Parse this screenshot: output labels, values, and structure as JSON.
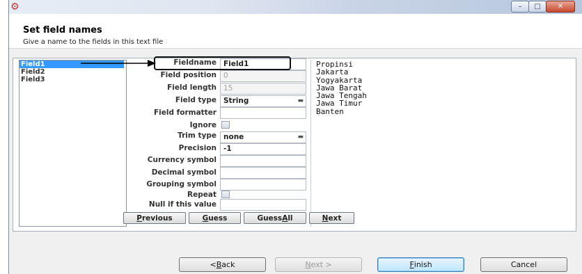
{
  "window": {
    "icon": "kettle-icon",
    "controls": {
      "minimize": "–",
      "maximize": "□",
      "close": "✕"
    }
  },
  "header": {
    "title": "Set field names",
    "subtitle": "Give a name to the fields in this text file"
  },
  "fields": [
    "Field1",
    "Field2",
    "Field3"
  ],
  "selected_field_index": 0,
  "form": {
    "fieldname": {
      "label": "Fieldname",
      "value": "Field1"
    },
    "field_position": {
      "label": "Field position",
      "value": "0"
    },
    "field_length": {
      "label": "Field length",
      "value": "15"
    },
    "field_type": {
      "label": "Field type",
      "value": "String"
    },
    "field_formatter": {
      "label": "Field formatter",
      "value": ""
    },
    "ignore": {
      "label": "Ignore",
      "checked": false
    },
    "trim_type": {
      "label": "Trim type",
      "value": "none"
    },
    "precision": {
      "label": "Precision",
      "value": "-1"
    },
    "currency_symbol": {
      "label": "Currency symbol",
      "value": ""
    },
    "decimal_symbol": {
      "label": "Decimal symbol",
      "value": ""
    },
    "grouping_symbol": {
      "label": "Grouping symbol",
      "value": ""
    },
    "repeat": {
      "label": "Repeat",
      "checked": false
    },
    "null_if": {
      "label": "Null if this value",
      "value": ""
    }
  },
  "actions": {
    "previous": {
      "pre": "",
      "key": "P",
      "post": "revious"
    },
    "guess": {
      "pre": "",
      "key": "G",
      "post": "uess"
    },
    "guess_all": {
      "pre": "Guess ",
      "key": "A",
      "post": "ll"
    },
    "next": {
      "pre": "",
      "key": "N",
      "post": "ext"
    }
  },
  "preview_lines": [
    "Propinsi",
    "Jakarta",
    "Yogyakarta",
    "Jawa Barat",
    "Jawa Tengah",
    "Jawa Timur",
    "Banten"
  ],
  "nav": {
    "back": {
      "pre": "< ",
      "key": "B",
      "post": "ack"
    },
    "next": {
      "pre": "",
      "key": "N",
      "post": "ext >"
    },
    "finish": {
      "pre": "",
      "key": "F",
      "post": "inish"
    },
    "cancel": "Cancel"
  }
}
